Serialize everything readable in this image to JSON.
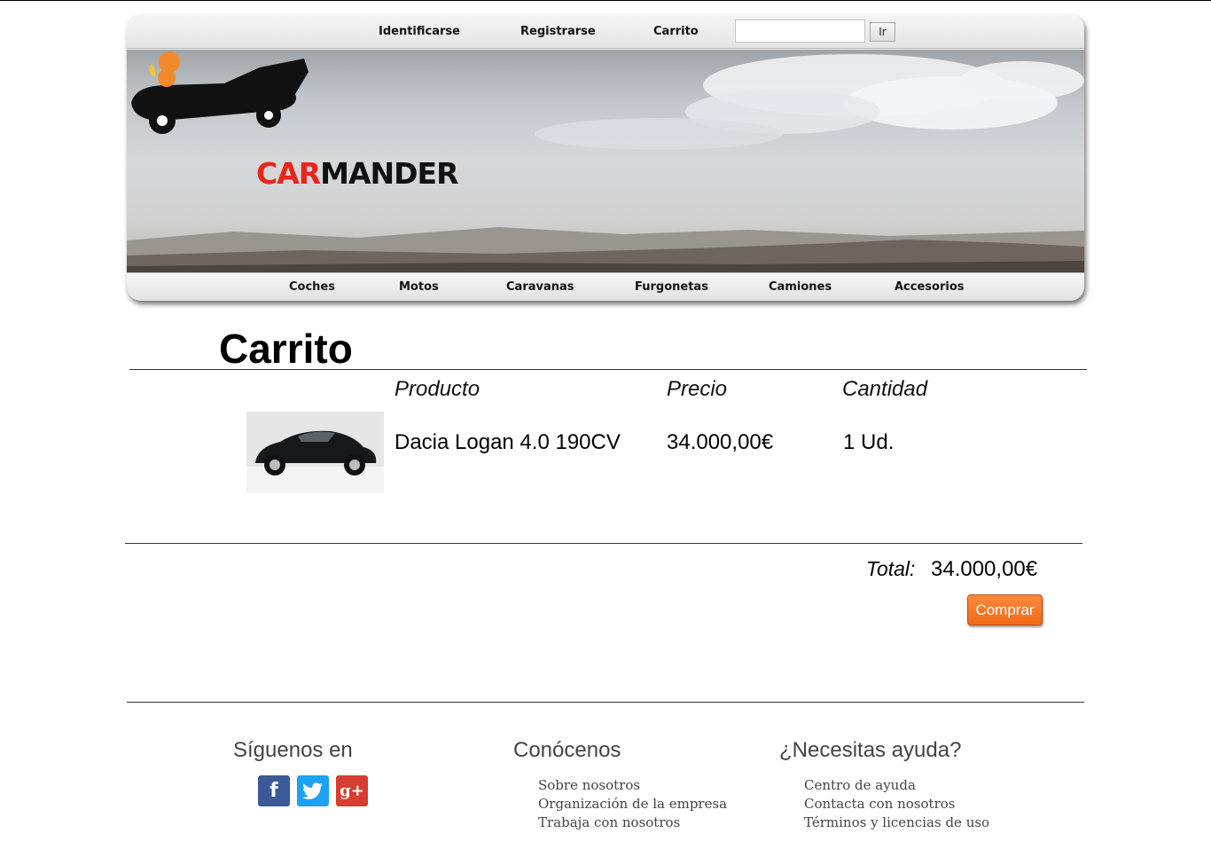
{
  "header": {
    "links": [
      "Identificarse",
      "Registrarse",
      "Carrito"
    ],
    "search": {
      "value": "",
      "button": "Ir"
    }
  },
  "brand": {
    "part1": "CAR",
    "part2": "MANDER"
  },
  "nav": [
    "Coches",
    "Motos",
    "Caravanas",
    "Furgonetas",
    "Camiones",
    "Accesorios"
  ],
  "cart": {
    "title": "Carrito",
    "columns": {
      "product": "Producto",
      "price": "Precio",
      "quantity": "Cantidad"
    },
    "items": [
      {
        "name": "Dacia Logan 4.0 190CV",
        "price": "34.000,00€",
        "quantity": "1 Ud."
      }
    ],
    "total_label": "Total:",
    "total_value": "34.000,00€",
    "buy_button": "Comprar"
  },
  "footer": {
    "social": {
      "title": "Síguenos en",
      "icons": [
        {
          "name": "facebook-icon",
          "glyph": "f",
          "color": "#3b5998"
        },
        {
          "name": "twitter-icon",
          "glyph": "🐦",
          "color": "#1da1f2"
        },
        {
          "name": "google-plus-icon",
          "glyph": "g+",
          "color": "#d73d32"
        }
      ]
    },
    "about": {
      "title": "Conócenos",
      "links": [
        "Sobre nosotros",
        "Organización de la empresa",
        "Trabaja con nosotros"
      ]
    },
    "help": {
      "title": "¿Necesitas ayuda?",
      "links": [
        "Centro de ayuda",
        "Contacta con nosotros",
        "Términos y licencias de uso"
      ]
    }
  },
  "colors": {
    "accent": "#f47b2a",
    "brand_red": "#e8251c"
  }
}
